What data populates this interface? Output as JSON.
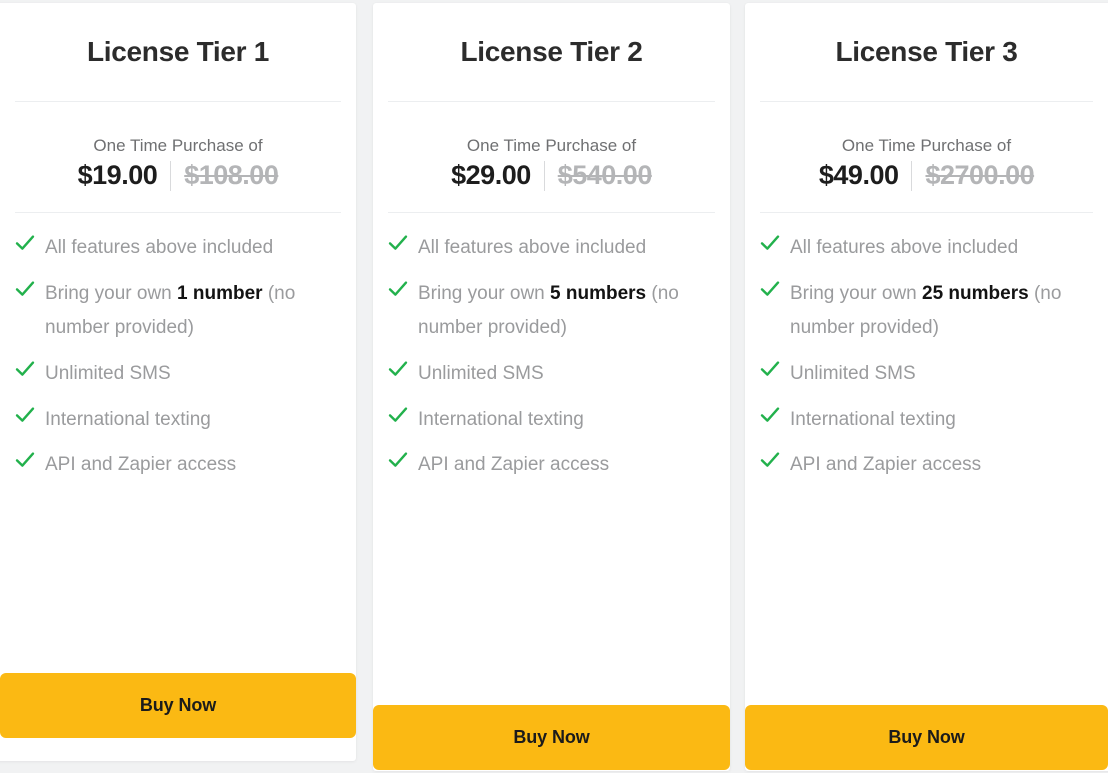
{
  "theme": {
    "page_background": "#f1f2f3",
    "card_background": "#ffffff",
    "check_color": "#22b14c",
    "button_color": "#fbb913",
    "button_text_color": "#1b1b1b",
    "title_color": "#2c2c2c",
    "feature_text_color": "#9a9b9d",
    "old_price_color": "#b4b5b7"
  },
  "cards": [
    {
      "title": "License Tier 1",
      "price_caption": "One Time Purchase of",
      "price_current": "$19.00",
      "price_old": "$108.00",
      "features": [
        {
          "pre": "All features above included",
          "strong": "",
          "post": ""
        },
        {
          "pre": "Bring your own ",
          "strong": "1 number",
          "post": " (no number provided)"
        },
        {
          "pre": "Unlimited SMS",
          "strong": "",
          "post": ""
        },
        {
          "pre": "International texting",
          "strong": "",
          "post": ""
        },
        {
          "pre": "API and Zapier access",
          "strong": "",
          "post": ""
        }
      ],
      "buy_label": "Buy Now"
    },
    {
      "title": "License Tier 2",
      "price_caption": "One Time Purchase of",
      "price_current": "$29.00",
      "price_old": "$540.00",
      "features": [
        {
          "pre": "All features above included",
          "strong": "",
          "post": ""
        },
        {
          "pre": "Bring your own ",
          "strong": "5 numbers",
          "post": " (no number provided)"
        },
        {
          "pre": "Unlimited SMS",
          "strong": "",
          "post": ""
        },
        {
          "pre": "International texting",
          "strong": "",
          "post": ""
        },
        {
          "pre": "API and Zapier access",
          "strong": "",
          "post": ""
        }
      ],
      "buy_label": "Buy Now"
    },
    {
      "title": "License Tier 3",
      "price_caption": "One Time Purchase of",
      "price_current": "$49.00",
      "price_old": "$2700.00",
      "features": [
        {
          "pre": "All features above included",
          "strong": "",
          "post": ""
        },
        {
          "pre": "Bring your own ",
          "strong": "25 numbers",
          "post": " (no number provided)"
        },
        {
          "pre": "Unlimited SMS",
          "strong": "",
          "post": ""
        },
        {
          "pre": "International texting",
          "strong": "",
          "post": ""
        },
        {
          "pre": "API and Zapier access",
          "strong": "",
          "post": ""
        }
      ],
      "buy_label": "Buy Now"
    }
  ]
}
